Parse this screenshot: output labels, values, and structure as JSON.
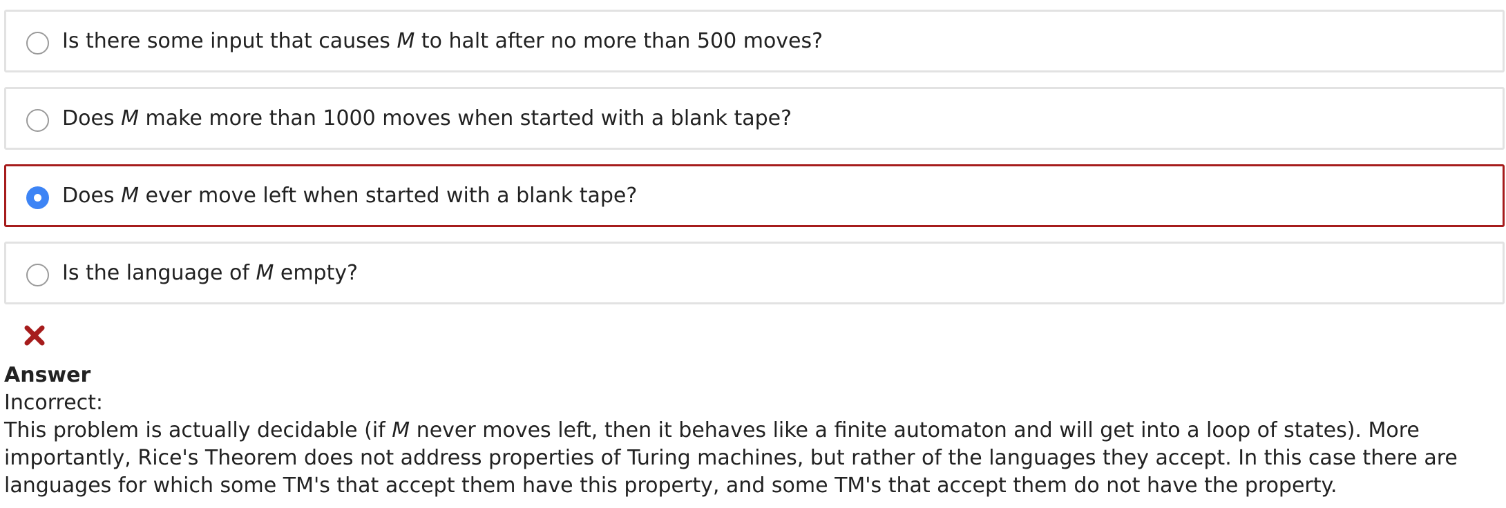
{
  "options": [
    {
      "before": "Is there some input that causes ",
      "var": "M",
      "after": " to halt after no more than 500 moves?",
      "selected": false
    },
    {
      "before": "Does ",
      "var": "M",
      "after": " make more than 1000 moves when started with a blank tape?",
      "selected": false
    },
    {
      "before": "Does ",
      "var": "M",
      "after": " ever move left when started with a blank tape?",
      "selected": true
    },
    {
      "before": "Is the language of ",
      "var": "M",
      "after": " empty?",
      "selected": false
    }
  ],
  "feedback": {
    "icon": "x-icon",
    "icon_color": "#a61c1c",
    "selected_border_color": "#a61c1c",
    "radio_checked_color": "#3d84f5"
  },
  "answer": {
    "title": "Answer",
    "status": "Incorrect:",
    "explanation_before": "This problem is actually decidable (if ",
    "explanation_var": "M",
    "explanation_after": " never moves left, then it behaves like a finite automaton and will get into a loop of states). More importantly, Rice's Theorem does not address properties of Turing machines, but rather of the languages they accept. In this case there are languages for which some TM's that accept them have this property, and some TM's that accept them do not have the property."
  }
}
